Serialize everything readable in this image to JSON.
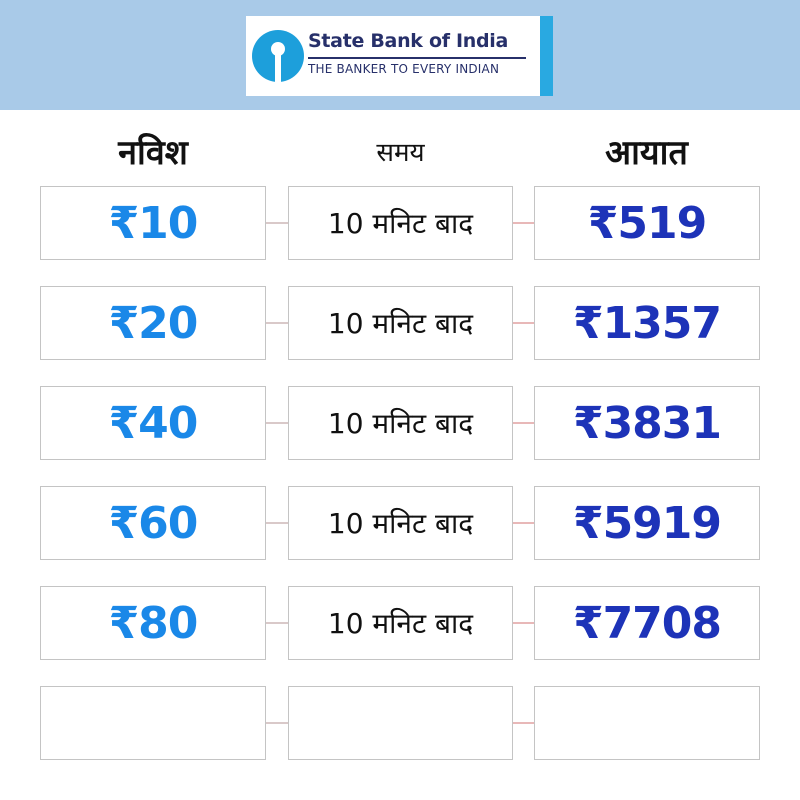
{
  "brand": {
    "name": "State Bank of India",
    "tagline": "THE BANKER TO EVERY INDIAN",
    "colors": {
      "header_bg": "#a9cae8",
      "logo_blue": "#1d9fdb",
      "text_navy": "#27306a"
    }
  },
  "headers": {
    "invest": "नविश",
    "time": "समय",
    "return": "आयात"
  },
  "rows": [
    {
      "invest": "₹10",
      "time": "10 मनिट बाद",
      "return": "₹519"
    },
    {
      "invest": "₹20",
      "time": "10 मनिट बाद",
      "return": "₹1357"
    },
    {
      "invest": "₹40",
      "time": "10 मनिट बाद",
      "return": "₹3831"
    },
    {
      "invest": "₹60",
      "time": "10 मनिट बाद",
      "return": "₹5919"
    },
    {
      "invest": "₹80",
      "time": "10 मनिट बाद",
      "return": "₹7708"
    },
    {
      "invest": "",
      "time": "",
      "return": ""
    }
  ],
  "colors": {
    "invest_text": "#1a88e8",
    "return_text": "#1d33b8",
    "cell_border": "#c4c4c4"
  }
}
